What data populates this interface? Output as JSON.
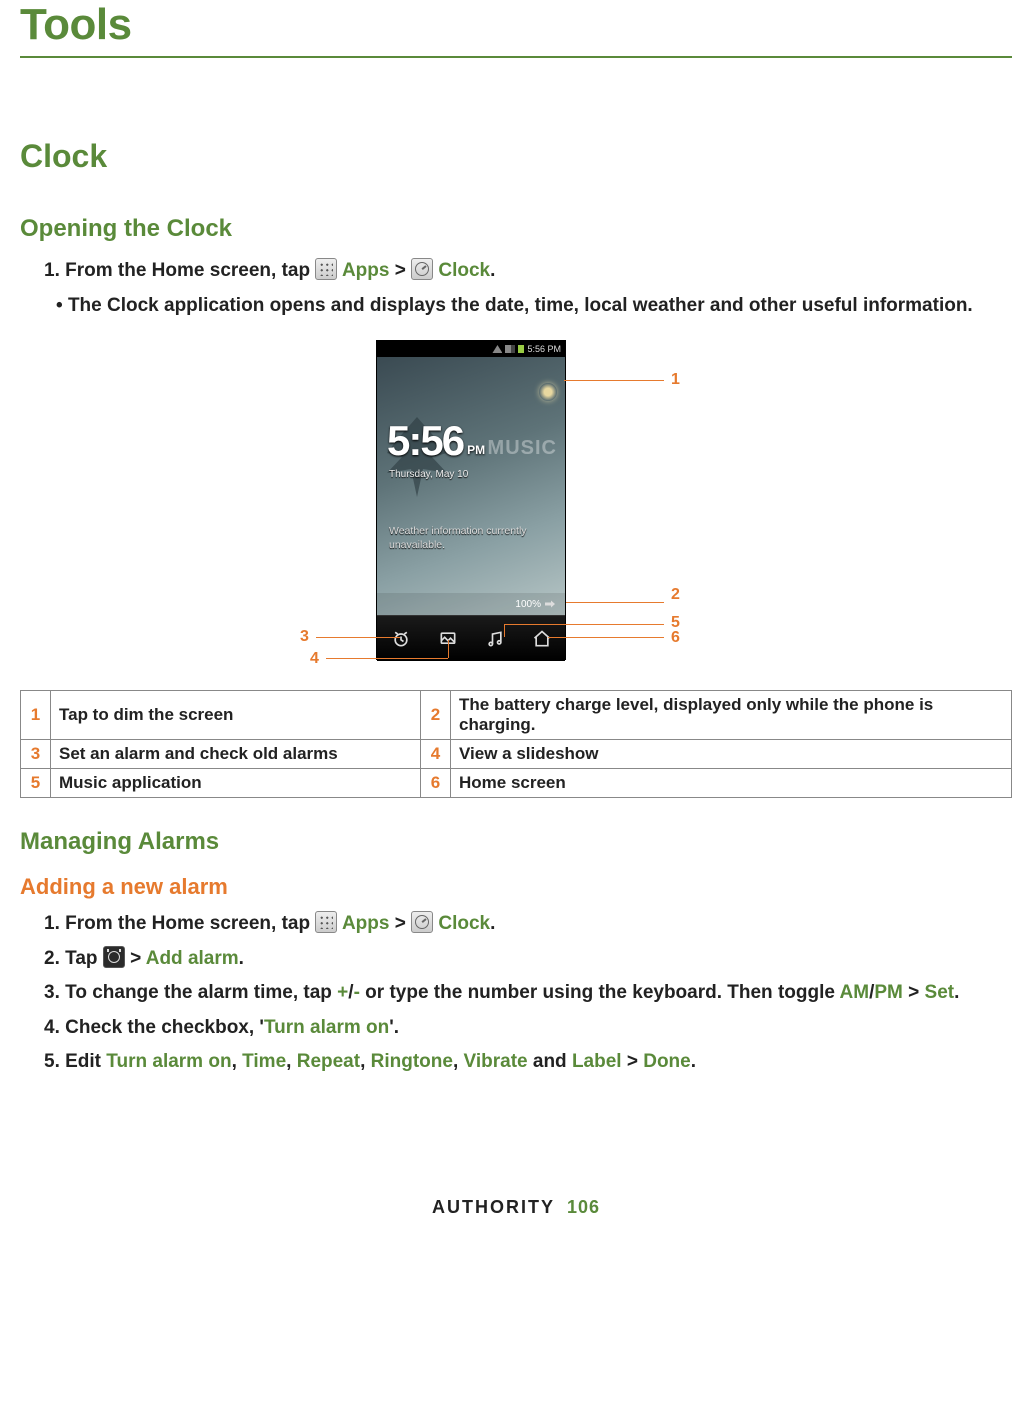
{
  "page_title": "Tools",
  "section": "Clock",
  "opening": {
    "heading": "Opening the Clock",
    "step1_prefix": "1. From the Home screen, tap ",
    "apps_label": "Apps",
    "gt": " > ",
    "clock_label": "Clock",
    "period": ".",
    "bullet": "The Clock application opens and displays the date, time, local weather and other useful information."
  },
  "phone": {
    "status_time": "5:56 PM",
    "big_time": "5:56",
    "ampm": "PM",
    "date": "Thursday, May 10",
    "music_logo": "MUSIC",
    "weather_line1": "Weather information currently",
    "weather_line2": "unavailable.",
    "battery_pct": "100%"
  },
  "callouts": {
    "c1": "1",
    "c2": "2",
    "c3": "3",
    "c4": "4",
    "c5": "5",
    "c6": "6"
  },
  "legend": {
    "r1n": "1",
    "r1t": "Tap to dim the screen",
    "r2n": "2",
    "r2t": "The battery charge level, displayed only while the phone is charging.",
    "r3n": "3",
    "r3t": "Set an alarm and check old alarms",
    "r4n": "4",
    "r4t": "View a slideshow",
    "r5n": "5",
    "r5t": "Music application",
    "r6n": "6",
    "r6t": "Home screen"
  },
  "managing": {
    "heading": "Managing Alarms",
    "adding_heading": "Adding a new alarm",
    "s1_prefix": "1. From the Home screen, tap ",
    "s2_prefix": "2. Tap ",
    "s2_gt": " > ",
    "s2_add": "Add alarm",
    "s2_period": ".",
    "s3_prefix": "3. To change the alarm time, tap ",
    "s3_plus": "+",
    "s3_slash": "/",
    "s3_minus": "-",
    "s3_mid": " or type the number using the keyboard. Then toggle ",
    "s3_am": "AM",
    "s3_slash2": "/",
    "s3_pm": "PM",
    "s3_gt": " > ",
    "s3_set": "Set",
    "s3_period": ".",
    "s4_prefix": "4. Check the checkbox, '",
    "s4_turn": "Turn alarm on",
    "s4_suffix": "'.",
    "s5_prefix": "5. Edit ",
    "s5_turn": "Turn alarm on",
    "s5_c1": ", ",
    "s5_time": "Time",
    "s5_c2": ", ",
    "s5_repeat": "Repeat",
    "s5_c3": ", ",
    "s5_ring": "Ringtone",
    "s5_c4": ", ",
    "s5_vib": "Vibrate",
    "s5_and": " and ",
    "s5_label": "Label",
    "s5_gt": " > ",
    "s5_done": "Done",
    "s5_period": "."
  },
  "footer": {
    "brand": "AUTHORITY",
    "page": "106"
  }
}
